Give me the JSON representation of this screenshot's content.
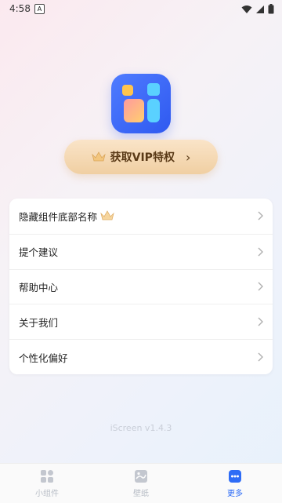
{
  "status": {
    "time": "4:58",
    "notif_letter": "A"
  },
  "vip": {
    "label": "获取VIP特权",
    "chevron": "›"
  },
  "menu": [
    {
      "label": "隐藏组件底部名称",
      "crown": true
    },
    {
      "label": "提个建议"
    },
    {
      "label": "帮助中心"
    },
    {
      "label": "关于我们"
    },
    {
      "label": "个性化偏好"
    }
  ],
  "version": "iScreen v1.4.3",
  "tabs": [
    {
      "label": "小组件",
      "icon": "widgets-icon",
      "active": false
    },
    {
      "label": "壁纸",
      "icon": "wallpaper-icon",
      "active": false
    },
    {
      "label": "更多",
      "icon": "more-icon",
      "active": true
    }
  ],
  "colors": {
    "accent": "#2e6cf6",
    "vip_text": "#5a3a17",
    "vip_bg": "#f0cfa2"
  }
}
